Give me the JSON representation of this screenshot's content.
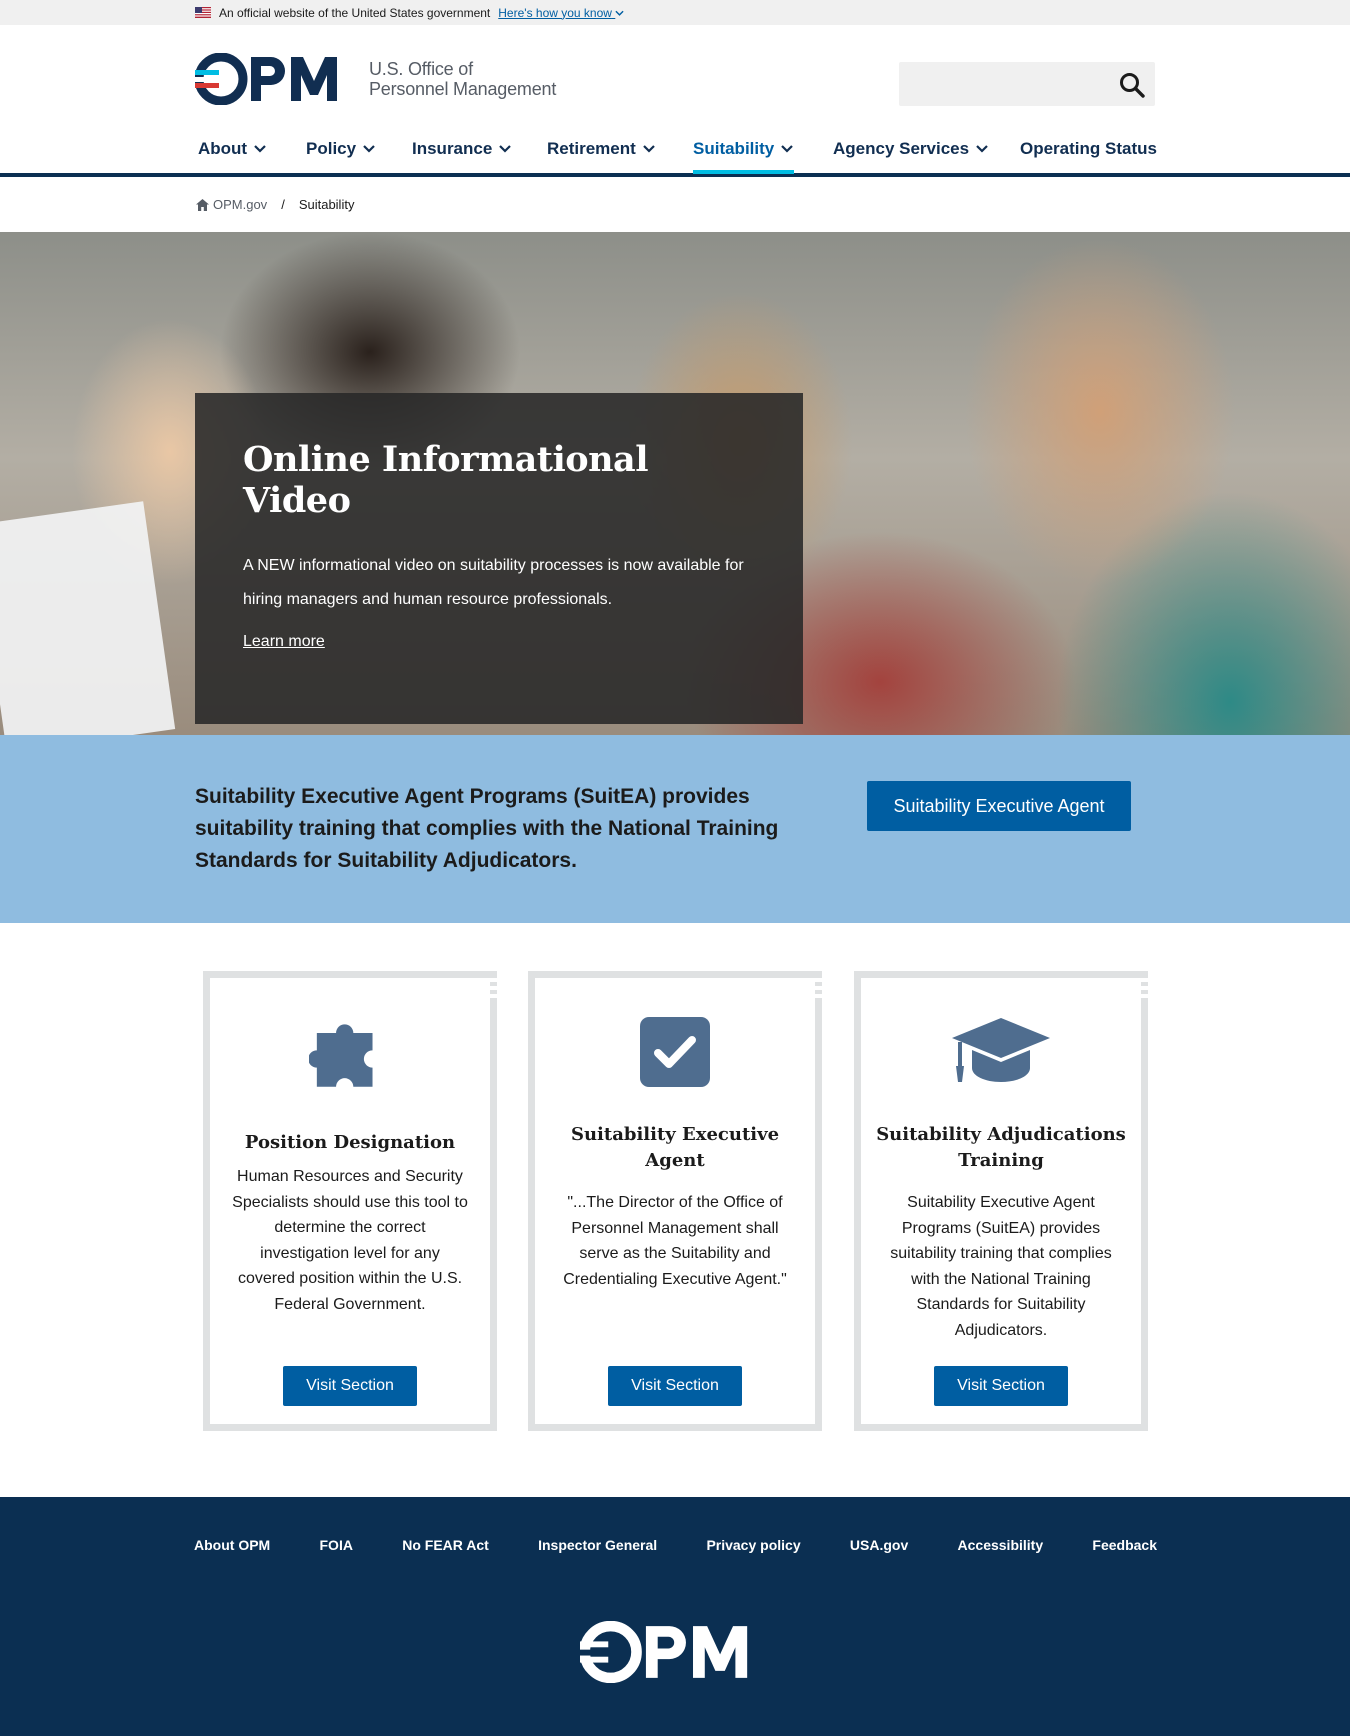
{
  "gov_banner": {
    "text": "An official website of the United States government",
    "link": "Here's how you know"
  },
  "logo": {
    "mark": "OPM",
    "line1": "U.S. Office of",
    "line2": "Personnel Management"
  },
  "search": {
    "placeholder": ""
  },
  "nav": [
    {
      "label": "About",
      "has_menu": true
    },
    {
      "label": "Policy",
      "has_menu": true
    },
    {
      "label": "Insurance",
      "has_menu": true
    },
    {
      "label": "Retirement",
      "has_menu": true
    },
    {
      "label": "Suitability",
      "has_menu": true,
      "active": true
    },
    {
      "label": "Agency Services",
      "has_menu": true
    },
    {
      "label": "Operating Status",
      "has_menu": false
    }
  ],
  "breadcrumb": {
    "home": "OPM.gov",
    "current": "Suitability"
  },
  "hero": {
    "title": "Online Informational Video",
    "text": "A NEW informational video on suitability processes is now available for hiring managers and human resource professionals.",
    "link": "Learn more"
  },
  "promo": {
    "text": "Suitability Executive Agent Programs (SuitEA) provides suitability training that complies with the National Training Standards for Suitability Adjudicators.",
    "button": "Suitability Executive Agent"
  },
  "cards": [
    {
      "icon": "puzzle-piece-icon",
      "title": "Position Designation",
      "body": "Human Resources and Security Specialists should use this tool to determine the correct investigation level for any covered position within the U.S. Federal Government.",
      "button": "Visit Section"
    },
    {
      "icon": "check-square-icon",
      "title": "Suitability Executive Agent",
      "body": "\"...The Director of the Office of Personnel Management shall serve as the Suitability and Credentialing Executive Agent.\"",
      "button": "Visit Section"
    },
    {
      "icon": "graduation-cap-icon",
      "title": "Suitability Adjudications Training",
      "body": "Suitability Executive Agent Programs (SuitEA) provides suitability training that complies with the National Training Standards for Suitability Adjudicators.",
      "button": "Visit Section"
    }
  ],
  "footer": {
    "links": [
      "About OPM",
      "FOIA",
      "No FEAR Act",
      "Inspector General",
      "Privacy policy",
      "USA.gov",
      "Accessibility",
      "Feedback"
    ],
    "logo": "OPM"
  },
  "colors": {
    "primary": "#005ea2",
    "navy": "#0b2f52",
    "accent": "#00bde3",
    "promo_bg": "#8fbce0",
    "icon": "#4f6d8f"
  }
}
